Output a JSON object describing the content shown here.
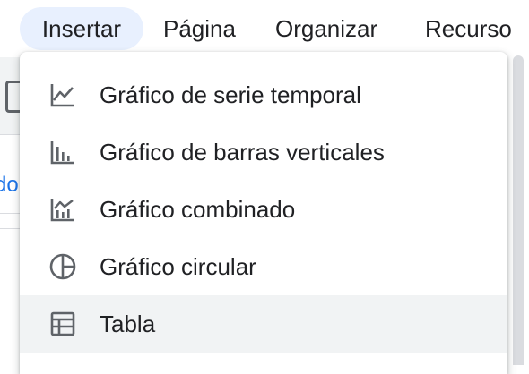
{
  "menubar": {
    "items": [
      {
        "label": "Insertar",
        "active": true
      },
      {
        "label": "Página"
      },
      {
        "label": "Organizar"
      },
      {
        "label": "Recurso"
      }
    ]
  },
  "background": {
    "link_fragment": "do"
  },
  "dropdown": {
    "items": [
      {
        "label": "Gráfico de serie temporal",
        "icon": "time-series-chart-icon"
      },
      {
        "label": "Gráfico de barras verticales",
        "icon": "vertical-bar-chart-icon"
      },
      {
        "label": "Gráfico combinado",
        "icon": "combo-chart-icon"
      },
      {
        "label": "Gráfico circular",
        "icon": "pie-chart-icon"
      },
      {
        "label": "Tabla",
        "icon": "table-icon",
        "highlighted": true
      }
    ]
  },
  "colors": {
    "active_menu_bg": "#e8f0fe",
    "hover_bg": "#f1f3f4",
    "icon": "#5f6368",
    "text": "#202124",
    "link": "#1a73e8"
  }
}
